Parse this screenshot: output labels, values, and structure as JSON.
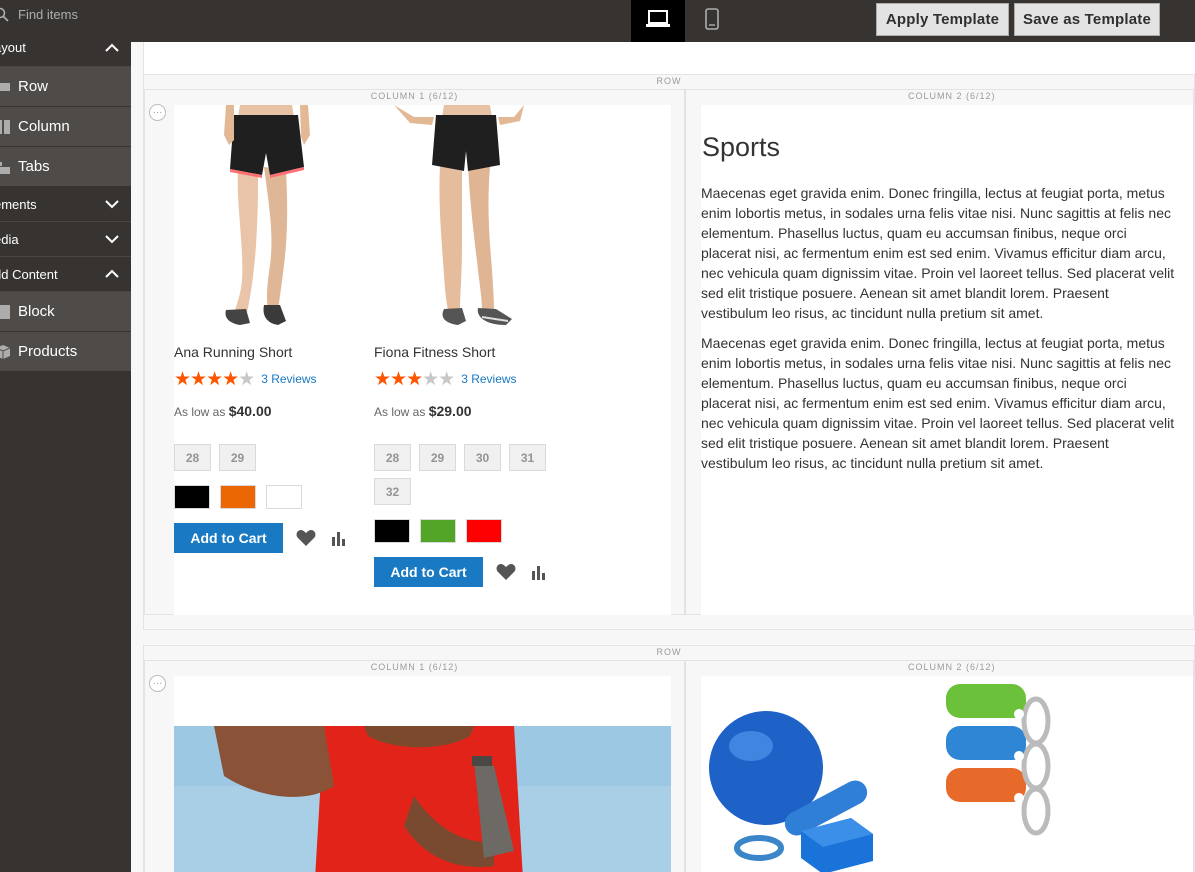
{
  "search": {
    "placeholder": "Find items"
  },
  "toolbar": {
    "apply_template": "Apply Template",
    "save_template": "Save as Template"
  },
  "sidebar": {
    "groups": [
      {
        "label": "Layout",
        "expanded": true,
        "items": [
          "Row",
          "Column",
          "Tabs"
        ]
      },
      {
        "label": "Elements",
        "expanded": false
      },
      {
        "label": "Media",
        "expanded": false
      },
      {
        "label": "Add Content",
        "expanded": true,
        "items": [
          "Block",
          "Products"
        ]
      }
    ],
    "visible_labels": {
      "layout": "ayout",
      "elements": "ements",
      "media": "edia",
      "add_content": "dd Content"
    }
  },
  "stage": {
    "row_label": "ROW",
    "col1_label": "COLUMN 1 (6/12)",
    "col2_label": "COLUMN 2 (6/12)",
    "products": [
      {
        "name": "Ana Running Short",
        "rating": 4,
        "reviews": "3  Reviews",
        "price_prefix": "As low as",
        "price": "$40.00",
        "sizes": [
          "28",
          "29"
        ],
        "colors": [
          "#000000",
          "#eb6703",
          "#ffffff"
        ],
        "cart": "Add to Cart"
      },
      {
        "name": "Fiona Fitness Short",
        "rating": 3,
        "reviews": "3  Reviews",
        "price_prefix": "As low as",
        "price": "$29.00",
        "sizes": [
          "28",
          "29",
          "30",
          "31",
          "32"
        ],
        "colors": [
          "#000000",
          "#53a528",
          "#ff0000"
        ],
        "cart": "Add to Cart"
      }
    ],
    "text_block": {
      "heading": "Sports",
      "para1_lines": [
        "Maecenas eget gravida enim. Donec fringilla, lectus at feugiat porta, metus",
        "enim lobortis metus, in sodales urna felis vitae nisi. Nunc sagittis at felis nec",
        "elementum. Phasellus luctus, quam eu accumsan finibus, neque orci",
        "placerat nisi, ac fermentum enim est sed enim. Vivamus efficitur diam arcu,",
        "nec vehicula quam dignissim vitae. Proin vel laoreet tellus. Sed placerat velit",
        "sed elit tristique posuere. Aenean sit amet blandit lorem. Praesent",
        "vestibulum leo risus, ac tincidunt nulla pretium sit amet."
      ],
      "para2_lines": [
        "Maecenas eget gravida enim. Donec fringilla, lectus at feugiat porta, metus",
        "enim lobortis metus, in sodales urna felis vitae nisi. Nunc sagittis at felis nec",
        "elementum. Phasellus luctus, quam eu accumsan finibus, neque orci",
        "placerat nisi, ac fermentum enim est sed enim. Vivamus efficitur diam arcu,",
        "nec vehicula quam dignissim vitae. Proin vel laoreet tellus. Sed placerat velit",
        "sed elit tristique posuere. Aenean sit amet blandit lorem. Praesent",
        "vestibulum leo risus, ac tincidunt nulla pretium sit amet."
      ]
    }
  },
  "colors": {
    "panel": "#373330",
    "accent": "#1979c3",
    "star": "#ff5501",
    "sidebar_item": "#4f4b48"
  }
}
